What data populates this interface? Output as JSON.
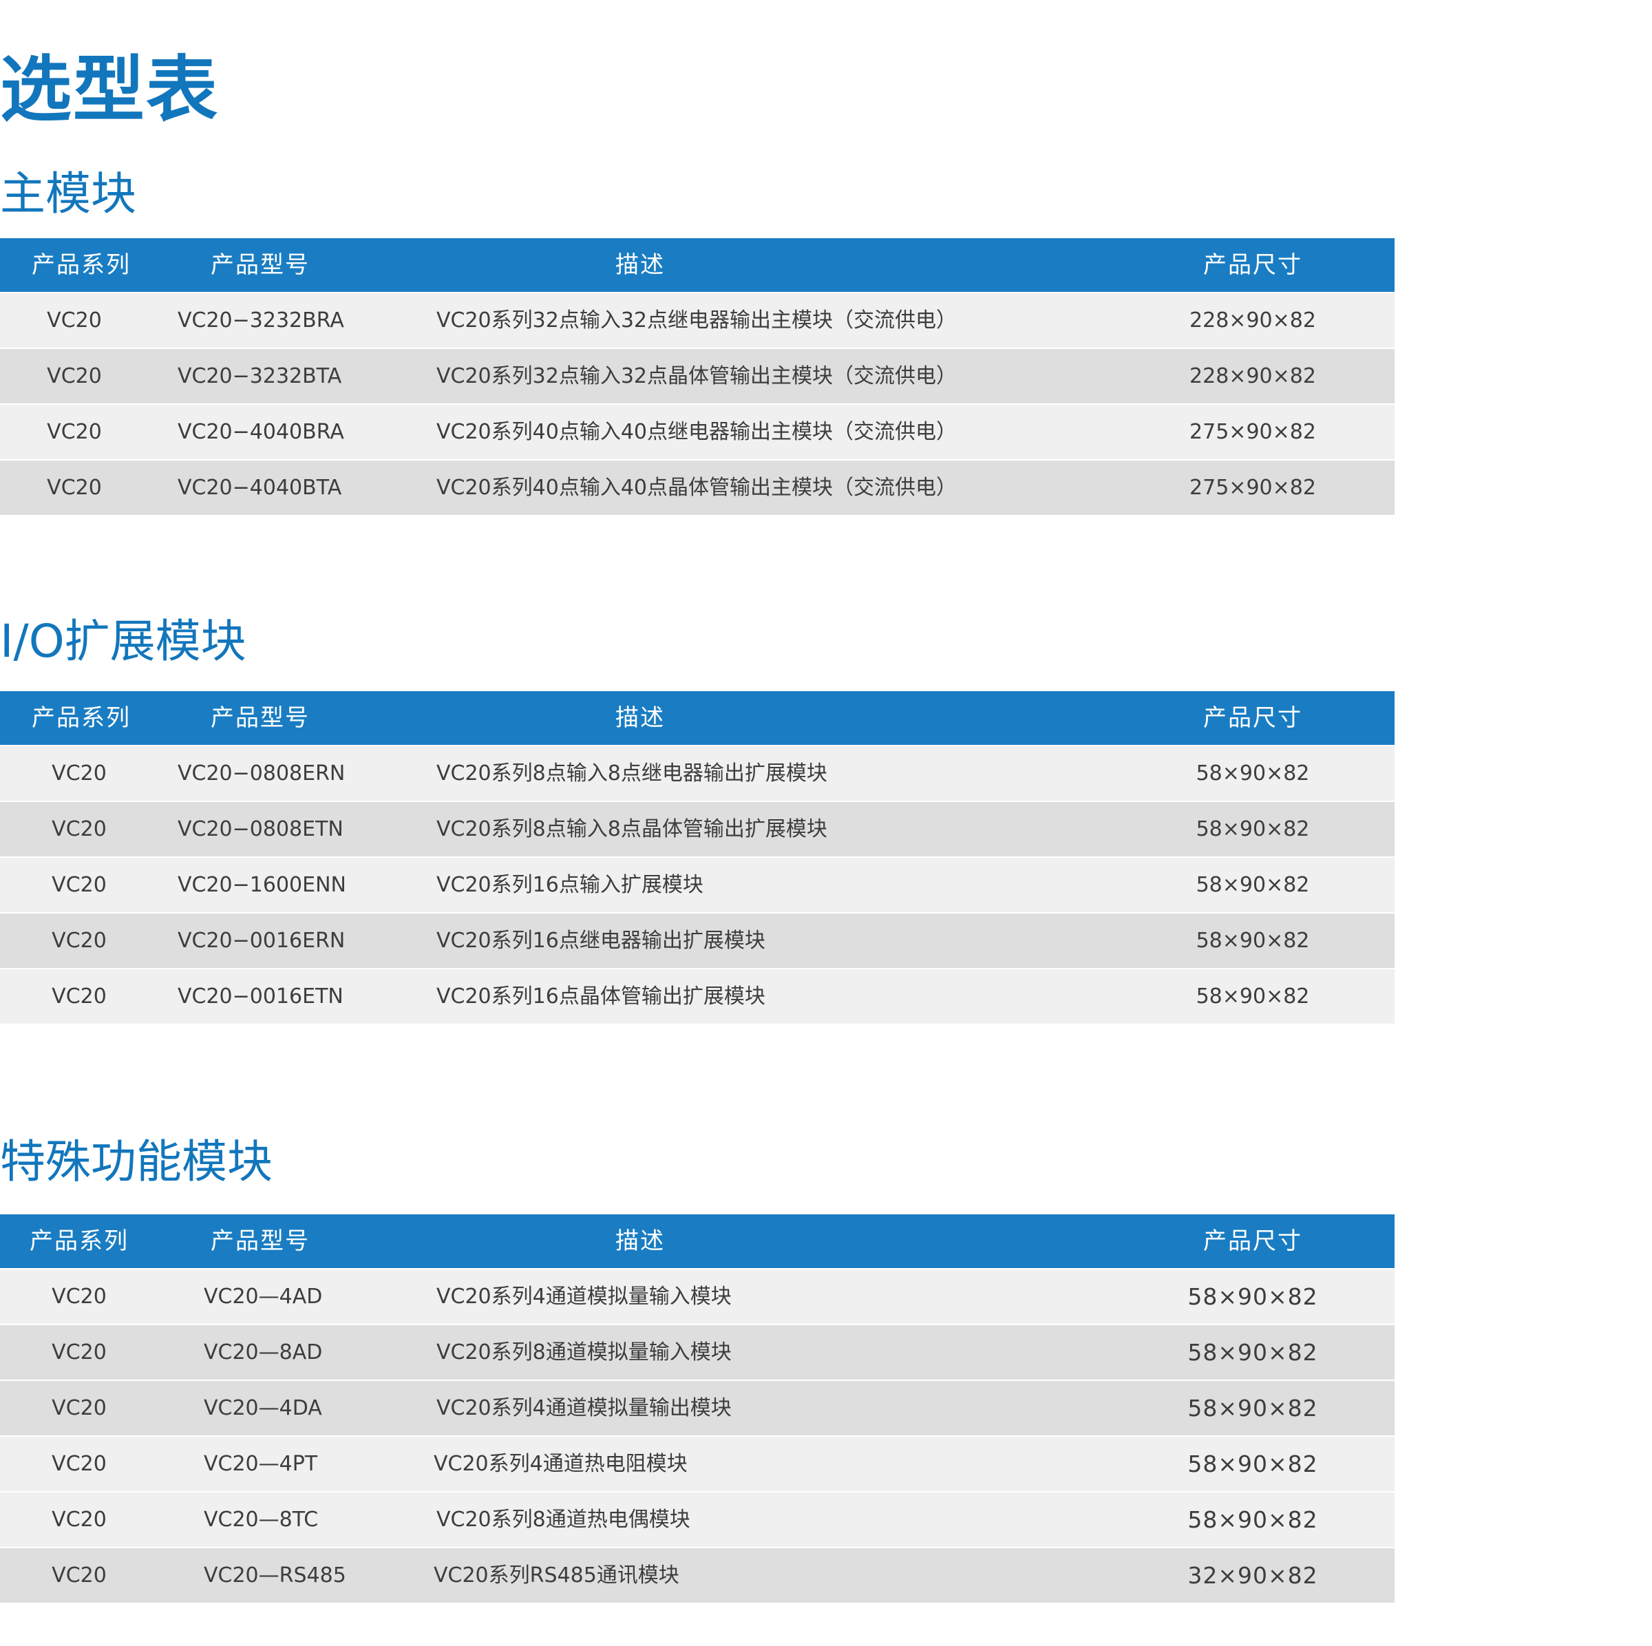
{
  "title": "选型表",
  "columns": {
    "series": "产品系列",
    "model": "产品型号",
    "desc": "描述",
    "size": "产品尺寸"
  },
  "sections": [
    {
      "title": "主模块",
      "rows": [
        {
          "series": "VC20",
          "model": "VC20−3232BRA",
          "desc": "VC20系列32点输入32点继电器输出主模块（交流供电）",
          "size": "228×90×82"
        },
        {
          "series": "VC20",
          "model": "VC20−3232BTA",
          "desc": "VC20系列32点输入32点晶体管输出主模块（交流供电）",
          "size": "228×90×82"
        },
        {
          "series": "VC20",
          "model": "VC20−4040BRA",
          "desc": "VC20系列40点输入40点继电器输出主模块（交流供电）",
          "size": "275×90×82"
        },
        {
          "series": "VC20",
          "model": "VC20−4040BTA",
          "desc": "VC20系列40点输入40点晶体管输出主模块（交流供电）",
          "size": "275×90×82"
        }
      ]
    },
    {
      "title": "I/O扩展模块",
      "rows": [
        {
          "series": "VC20",
          "model": "VC20−0808ERN",
          "desc": "VC20系列8点输入8点继电器输出扩展模块",
          "size": "58×90×82"
        },
        {
          "series": "VC20",
          "model": "VC20−0808ETN",
          "desc": "VC20系列8点输入8点晶体管输出扩展模块",
          "size": "58×90×82"
        },
        {
          "series": "VC20",
          "model": "VC20−1600ENN",
          "desc": "VC20系列16点输入扩展模块",
          "size": "58×90×82"
        },
        {
          "series": "VC20",
          "model": "VC20−0016ERN",
          "desc": "VC20系列16点继电器输出扩展模块",
          "size": "58×90×82"
        },
        {
          "series": "VC20",
          "model": "VC20−0016ETN",
          "desc": "VC20系列16点晶体管输出扩展模块",
          "size": "58×90×82"
        }
      ]
    },
    {
      "title": "特殊功能模块",
      "rows": [
        {
          "series": "VC20",
          "model": "VC20—4AD",
          "desc": "VC20系列4通道模拟量输入模块",
          "size": "58×90×82"
        },
        {
          "series": "VC20",
          "model": "VC20—8AD",
          "desc": "VC20系列8通道模拟量输入模块",
          "size": "58×90×82"
        },
        {
          "series": "VC20",
          "model": "VC20—4DA",
          "desc": "VC20系列4通道模拟量输出模块",
          "size": "58×90×82"
        },
        {
          "series": "VC20",
          "model": "VC20—4PT",
          "desc": "VC20系列4通道热电阻模块",
          "size": "58×90×82"
        },
        {
          "series": "VC20",
          "model": "VC20—8TC",
          "desc": "VC20系列8通道热电偶模块",
          "size": "58×90×82"
        },
        {
          "series": "VC20",
          "model": "VC20—RS485",
          "desc": "VC20系列RS485通讯模块",
          "size": "32×90×82"
        }
      ]
    }
  ]
}
